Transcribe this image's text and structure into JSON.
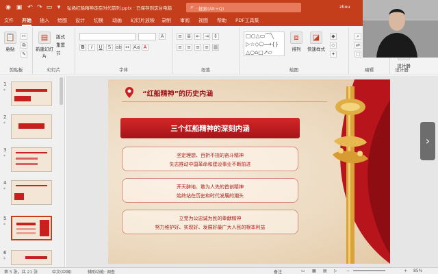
{
  "titlebar": {
    "filename": "弘扬红船精神走在时代前列.pptx",
    "save_status": "已保存到这台电脑",
    "search_placeholder": "搜索(Alt+Q)",
    "user": "zhou"
  },
  "menu_tabs": [
    {
      "label": "文件",
      "active": false
    },
    {
      "label": "开始",
      "active": true
    },
    {
      "label": "插入",
      "active": false
    },
    {
      "label": "绘图",
      "active": false
    },
    {
      "label": "设计",
      "active": false
    },
    {
      "label": "切换",
      "active": false
    },
    {
      "label": "动画",
      "active": false
    },
    {
      "label": "幻灯片放映",
      "active": false
    },
    {
      "label": "录制",
      "active": false
    },
    {
      "label": "审阅",
      "active": false
    },
    {
      "label": "视图",
      "active": false
    },
    {
      "label": "帮助",
      "active": false
    },
    {
      "label": "PDF工具集",
      "active": false
    }
  ],
  "ribbon": {
    "paste_label": "粘贴",
    "new_slide_label": "新建幻灯片",
    "layout_label": "版式",
    "reset_label": "重置",
    "section_label": "节",
    "arrange_label": "排列",
    "quick_styles_label": "快速样式",
    "designer_label": "设计器",
    "groups": {
      "clipboard": "剪贴板",
      "slides": "幻灯片",
      "font": "字体",
      "paragraph": "段落",
      "drawing": "绘图",
      "editing": "编辑",
      "designer": "设计器"
    }
  },
  "thumbnails": [
    {
      "num": "1",
      "star": "*"
    },
    {
      "num": "2",
      "star": "*"
    },
    {
      "num": "3",
      "star": "*"
    },
    {
      "num": "4",
      "star": "*"
    },
    {
      "num": "5",
      "star": "*"
    },
    {
      "num": "6",
      "star": "*"
    }
  ],
  "slide": {
    "title": "“红船精神”的历史内涵",
    "banner": "三个红船精神的深刻内涵",
    "cards": [
      {
        "line1": "坚定理想、百折不挠的奋斗精神",
        "line2": "矢志推动中国革命和建设事业不断前进"
      },
      {
        "line1": "开天辟地、敢为人先的首创精神",
        "line2": "始终站在历史和时代发展的潮头"
      },
      {
        "line1": "立党为公忠诚为民的奉献精神",
        "line2": "努力维护好、实现好、发展好最广大人民的根本利益"
      }
    ]
  },
  "statusbar": {
    "slide_info": "第 5 张，共 21 张",
    "language": "中文(中国)",
    "accessibility": "辅助功能: 调查",
    "notes": "备注",
    "zoom": "85%"
  },
  "colors": {
    "accent": "#c43e1c",
    "banner_red": "#c81f1f",
    "title_red": "#a3151a"
  }
}
